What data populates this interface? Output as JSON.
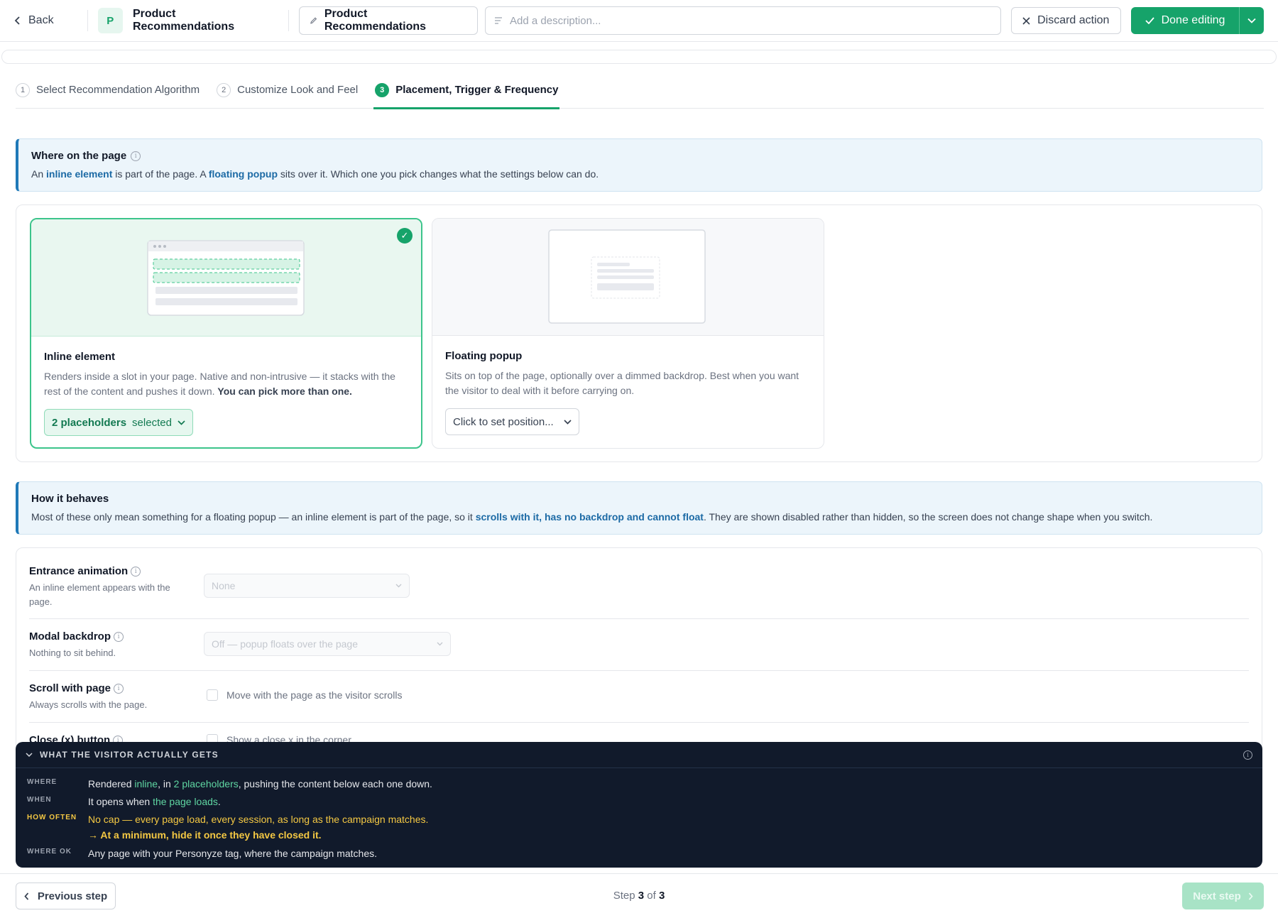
{
  "topbar": {
    "back_label": "Back",
    "logo_letter": "P",
    "app_title": "Product Recommendations",
    "name_value": "Product Recommendations",
    "description_placeholder": "Add a description...",
    "discard_label": "Discard action",
    "done_label": "Done editing"
  },
  "steps": [
    {
      "num": "1",
      "label": "Select Recommendation Algorithm",
      "active": false
    },
    {
      "num": "2",
      "label": "Customize Look and Feel",
      "active": false
    },
    {
      "num": "3",
      "label": "Placement, Trigger & Frequency",
      "active": true
    }
  ],
  "where_banner": {
    "title": "Where on the page",
    "text_1": "An ",
    "bold_1": "inline element",
    "text_2": " is part of the page. A ",
    "bold_2": "floating popup",
    "text_3": " sits over it. Which one you pick changes what the settings below can do."
  },
  "cards": {
    "inline": {
      "title": "Inline element",
      "desc": "Renders inside a slot in your page. Native and non-intrusive — it stacks with the rest of the content and pushes it down. ",
      "desc_bold": "You can pick more than one.",
      "button_bold": "2 placeholders",
      "button_rest": "selected",
      "selected": true
    },
    "popup": {
      "title": "Floating popup",
      "desc": "Sits on top of the page, optionally over a dimmed backdrop. Best when you want the visitor to deal with it before carrying on.",
      "button": "Click to set position..."
    }
  },
  "behaves_banner": {
    "title": "How it behaves",
    "text_1": "Most of these only mean something for a floating popup — an inline element is part of the page, so it ",
    "bold_1": "scrolls with it, has no backdrop and cannot float",
    "text_2": ". They are shown disabled rather than hidden, so the screen does not change shape when you switch."
  },
  "settings": {
    "entrance": {
      "label": "Entrance animation",
      "hint": "An inline element appears with the page.",
      "value": "None"
    },
    "backdrop": {
      "label": "Modal backdrop",
      "hint": "Nothing to sit behind.",
      "value": "Off — popup floats over the page"
    },
    "scroll": {
      "label": "Scroll with page",
      "hint": "Always scrolls with the page.",
      "checkbox_label": "Move with the page as the visitor scrolls"
    },
    "close": {
      "label": "Close (x) button",
      "checkbox_label": "Show a close x in the corner"
    }
  },
  "summary": {
    "title": "WHAT THE VISITOR ACTUALLY GETS",
    "where": {
      "key": "WHERE",
      "t1": "Rendered ",
      "g1": "inline",
      "t2": ", in ",
      "g2": "2 placeholders",
      "t3": ", pushing the content below each one down."
    },
    "when": {
      "key": "WHEN",
      "t1": "It opens when ",
      "g1": "the page loads",
      "t2": "."
    },
    "how_often": {
      "key": "HOW OFTEN",
      "line1": "No cap — every page load, every session, as long as the campaign matches.",
      "line2": "→ At a minimum, hide it once they have closed it."
    },
    "where_ok": {
      "key": "WHERE OK",
      "text": "Any page with your Personyze tag, where the campaign matches."
    }
  },
  "footer": {
    "prev_label": "Previous step",
    "step_word": "Step",
    "current": "3",
    "of_word": "of",
    "total": "3",
    "next_label": "Next step"
  },
  "colors": {
    "accent": "#16a36a",
    "info_blue": "#1f79b8",
    "summary_bg": "#111a2b",
    "summary_green": "#5fd6a2",
    "summary_yellow": "#f4c843"
  }
}
